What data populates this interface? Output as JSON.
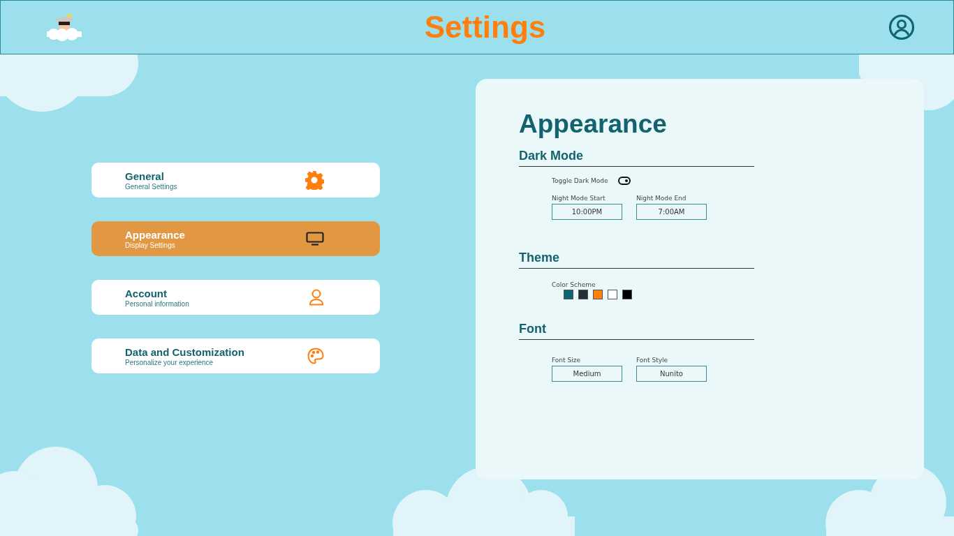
{
  "header": {
    "title": "Settings"
  },
  "menu": [
    {
      "title": "General",
      "subtitle": "General Settings",
      "kind": "gear",
      "selected": false
    },
    {
      "title": "Appearance",
      "subtitle": "Display Settings",
      "kind": "monitor",
      "selected": true
    },
    {
      "title": "Account",
      "subtitle": "Personal information",
      "kind": "person",
      "selected": false
    },
    {
      "title": "Data and Customization",
      "subtitle": "Personalize your experience",
      "kind": "palette",
      "selected": false
    }
  ],
  "panel": {
    "title": "Appearance",
    "sections": [
      {
        "heading": "Dark Mode",
        "toggle": {
          "label": "Toggle Dark Mode",
          "on": true
        },
        "fields": [
          {
            "label": "Night Mode Start",
            "value": "10:00PM"
          },
          {
            "label": "Night Mode End",
            "value": "7:00AM"
          }
        ]
      },
      {
        "heading": "Theme",
        "swatch_label": "Color Scheme",
        "swatches": [
          {
            "color": "#0f6670"
          },
          {
            "color": "#233039"
          },
          {
            "color": "#ff7f0e"
          },
          {
            "color": "#ffffff"
          },
          {
            "color": "#000000"
          }
        ]
      },
      {
        "heading": "Font",
        "fields": [
          {
            "label": "Font Size",
            "value": "Medium"
          },
          {
            "label": "Font Style",
            "value": "Nunito"
          }
        ]
      }
    ]
  }
}
